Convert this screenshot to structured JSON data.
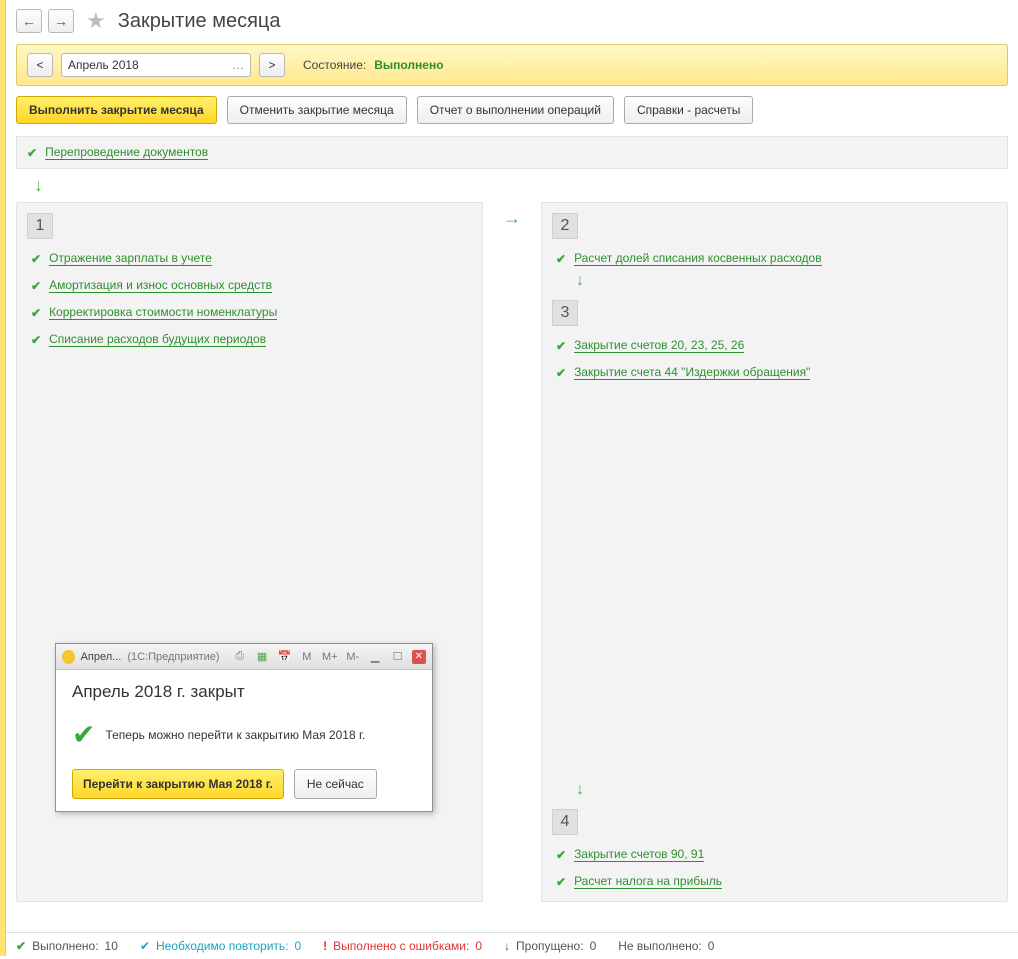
{
  "header": {
    "title": "Закрытие месяца"
  },
  "period": {
    "value": "Апрель 2018",
    "prev": "<",
    "next": ">",
    "status_label": "Состояние:",
    "status_value": "Выполнено"
  },
  "actions": {
    "execute": "Выполнить закрытие месяца",
    "cancel": "Отменить закрытие месяца",
    "report": "Отчет о выполнении операций",
    "references": "Справки - расчеты"
  },
  "top_op": {
    "label": "Перепроведение документов"
  },
  "left_stage": {
    "num": "1",
    "items": [
      {
        "label": "Отражение зарплаты в учете"
      },
      {
        "label": "Амортизация и износ основных средств"
      },
      {
        "label": "Корректировка стоимости номенклатуры"
      },
      {
        "label": "Списание расходов будущих периодов"
      }
    ]
  },
  "right_stage_a": {
    "num": "2",
    "items": [
      {
        "label": "Расчет долей списания косвенных расходов"
      }
    ]
  },
  "right_stage_b": {
    "num": "3",
    "items": [
      {
        "label": "Закрытие счетов 20, 23, 25, 26"
      },
      {
        "label": "Закрытие счета 44 \"Издержки обращения\""
      }
    ]
  },
  "right_stage_c": {
    "num": "4",
    "items": [
      {
        "label": "Закрытие счетов 90, 91"
      },
      {
        "label": "Расчет налога на прибыль"
      }
    ]
  },
  "modal": {
    "title_app": "Апрел...",
    "title_app_hint": "(1С:Предприятие)",
    "tb_m": "M",
    "tb_mplus": "M+",
    "tb_mminus": "M-",
    "heading": "Апрель 2018 г. закрыт",
    "message": "Теперь можно перейти к закрытию Мая 2018 г.",
    "btn_go": "Перейти к закрытию Мая 2018 г.",
    "btn_later": "Не сейчас"
  },
  "footer": {
    "done_label": "Выполнено:",
    "done_value": "10",
    "repeat_label": "Необходимо повторить:",
    "repeat_value": "0",
    "err_label": "Выполнено с ошибками:",
    "err_value": "0",
    "skip_label": "Пропущено:",
    "skip_value": "0",
    "none_label": "Не выполнено:",
    "none_value": "0"
  }
}
